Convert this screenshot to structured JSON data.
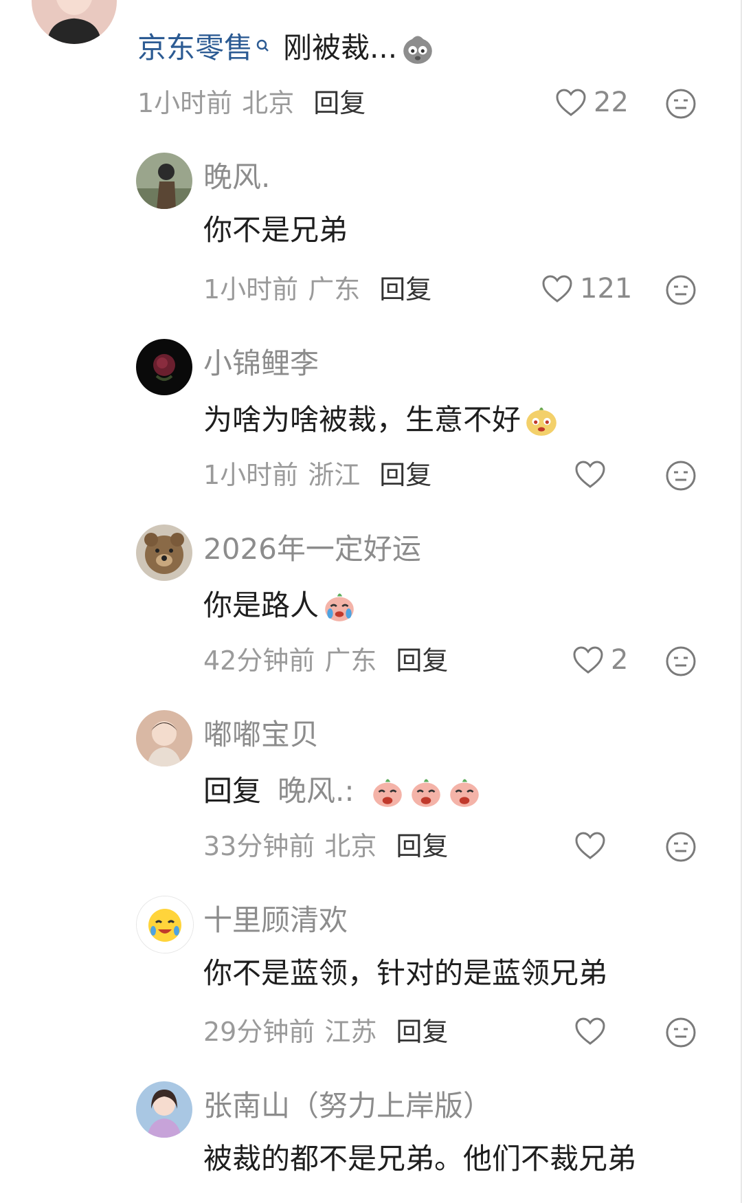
{
  "top_comment": {
    "cut_name": "",
    "text_link": "京东零售",
    "text_link_icon": "search-icon",
    "text_rest": "刚被裁...",
    "emoji": "sad-face-emoji",
    "time": "1小时前",
    "location": "北京",
    "reply_label": "回复",
    "likes": "22"
  },
  "replies": [
    {
      "name": "晚风.",
      "text": "你不是兄弟",
      "time": "1小时前",
      "location": "广东",
      "reply_label": "回复",
      "likes": "121"
    },
    {
      "name": "小锦鲤李",
      "text": "为啥为啥被裁，生意不好",
      "emoji": "crying-bun-emoji",
      "time": "1小时前",
      "location": "浙江",
      "reply_label": "回复",
      "likes": ""
    },
    {
      "name": "2026年一定好运",
      "text": "你是路人",
      "emoji": "crying-peach-emoji",
      "time": "42分钟前",
      "location": "广东",
      "reply_label": "回复",
      "likes": "2"
    },
    {
      "name": "嘟嘟宝贝",
      "reply_prefix": "回复",
      "reply_target": "晚风.:",
      "emoji": "giggling-peach-emoji",
      "time": "33分钟前",
      "location": "北京",
      "reply_label": "回复",
      "likes": ""
    },
    {
      "name": "十里顾清欢",
      "text": "你不是蓝领，针对的是蓝领兄弟",
      "time": "29分钟前",
      "location": "江苏",
      "reply_label": "回复",
      "likes": ""
    },
    {
      "name": "张南山（努力上岸版）",
      "text": "被裁的都不是兄弟。他们不裁兄弟"
    }
  ],
  "colors": {
    "name_gray": "#8c8c8c",
    "text_dark": "#1e1e1e",
    "link_blue": "#2c5b93",
    "meta_gray": "#9a9a9a"
  }
}
